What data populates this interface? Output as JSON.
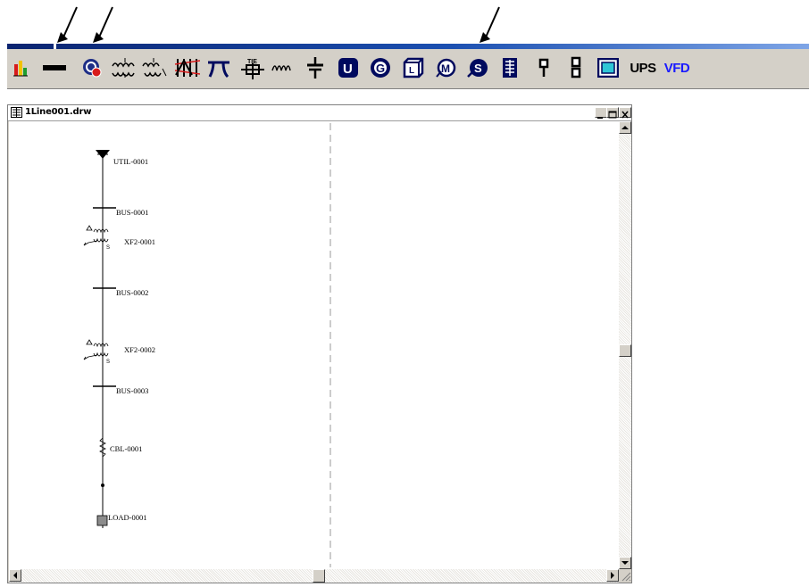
{
  "toolbar": {
    "ups_label": "UPS",
    "vfd_label": "VFD"
  },
  "window": {
    "title": "1Line001.drw"
  },
  "diagram": {
    "labels": {
      "util": "UTIL-0001",
      "bus1": "BUS-0001",
      "xf1": "XF2-0001",
      "bus2": "BUS-0002",
      "xf2": "XF2-0002",
      "bus3": "BUS-0003",
      "cbl": "CBL-0001",
      "load": "LOAD-0001"
    }
  },
  "icons": [
    "pointer-arrow-icon",
    "bar-chart-icon",
    "bus-icon",
    "utility-icon",
    "transformer-2w-icon",
    "transformer-3w-icon",
    "impedance-icon",
    "pi-line-icon",
    "tie-breaker-icon",
    "reactor-icon",
    "capacitor-icon",
    "ups-device-icon",
    "generator-icon",
    "load-icon",
    "motor-icon",
    "synchronous-motor-icon",
    "panel-icon",
    "fuse-icon",
    "switch-icon",
    "screen-icon"
  ],
  "colors": {
    "title_gradient_start": "#0a2470",
    "generator_red": "#cc2a2a",
    "dark_navy": "#000a5e",
    "vfd_blue": "#1a1aff",
    "win_face": "#d4d0c8"
  }
}
